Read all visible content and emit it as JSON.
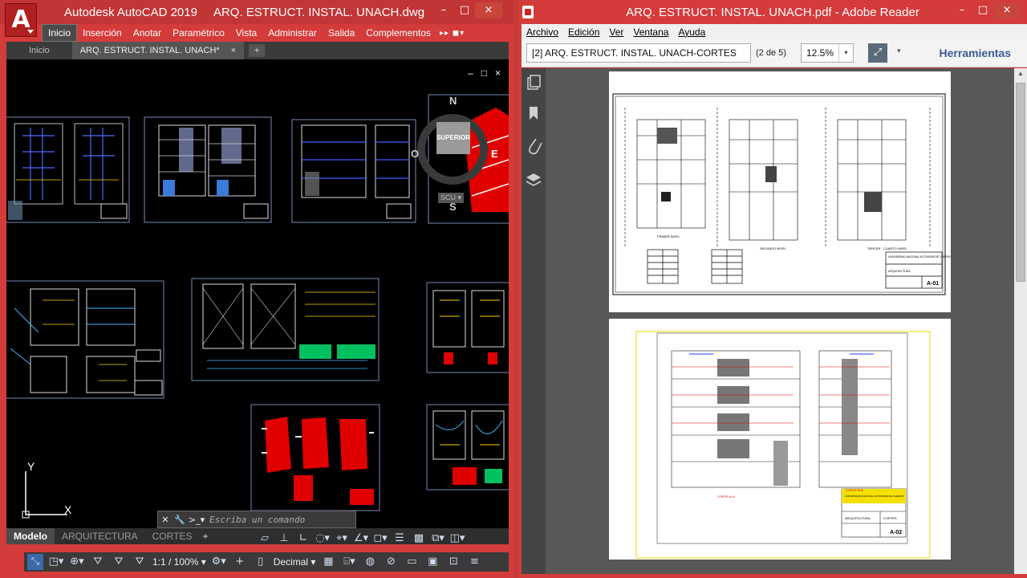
{
  "autocad": {
    "app_name": "Autodesk AutoCAD 2019",
    "document_title": "ARQ. ESTRUCT. INSTAL. UNACH.dwg",
    "logo_letter": "A",
    "ribbon_tabs": [
      "Inicio",
      "Inserción",
      "Anotar",
      "Paramétrico",
      "Vista",
      "Administrar",
      "Salida",
      "Complementos"
    ],
    "ribbon_extra": "▸▸ ◼▾",
    "doc_tabs": {
      "start": "Inicio",
      "active": "ARQ. ESTRUCT. INSTAL. UNACH*",
      "close": "×",
      "add": "+"
    },
    "viewport_controls": [
      "–",
      "□",
      "×"
    ],
    "viewcube": {
      "north": "N",
      "south": "S",
      "west": "O",
      "east": "E",
      "face": "SUPERIOR",
      "ucs_menu": "SCU ▾"
    },
    "ucs_icon": {
      "x": "X",
      "y": "Y"
    },
    "command_line": {
      "placeholder": "Escriba un comando",
      "close": "✕",
      "settings": "🔧",
      "prompt": ">_▾"
    },
    "layout_tabs": [
      "Modelo",
      "ARQUITECTURA",
      "CORTES"
    ],
    "layout_add": "+",
    "status_row1": [
      "▱",
      "⊥",
      "∟",
      "◌▾",
      "⌖▾",
      "∠▾",
      "◻▾",
      "☰",
      "▩",
      "⧉▾",
      "◫▾"
    ],
    "status_row2": [
      "⤡",
      "◳▾",
      "⊕▾",
      "⛛",
      "⛛",
      "⛛",
      "1:1 / 100% ▾",
      "⚙▾",
      "+",
      "▯",
      "Decimal ▾",
      "▦",
      "⌸▾",
      "◍",
      "⊘",
      "▭",
      "▣",
      "⊡",
      "≡"
    ],
    "colors": {
      "titlebar": "#c23535",
      "canvas": "#000000",
      "sheet_border": "#7a8ab8"
    }
  },
  "reader": {
    "window_title": "ARQ. ESTRUCT. INSTAL. UNACH.pdf - Adobe Reader",
    "menu": [
      "Archivo",
      "Edición",
      "Ver",
      "Ventana",
      "Ayuda"
    ],
    "document_name": "[2] ARQ. ESTRUCT. INSTAL. UNACH-CORTES",
    "page_counter": "(2 de 5)",
    "zoom": "12.5%",
    "zoom_dropdown": "▾",
    "expand_icon": "⤢",
    "arrow_icon": "▾",
    "tools_label": "Herramientas",
    "sidebar_icons": [
      "pages-icon",
      "bookmark-icon",
      "attachment-icon",
      "layers-icon"
    ],
    "window_buttons": [
      "–",
      "□",
      "×"
    ],
    "page1": {
      "labels": [
        "PRIMER NIVEL",
        "SEGUNDO NIVEL",
        "TERCER - CUARTO NIVEL"
      ],
      "sheet_id": "A-01",
      "org": "UNIVERSIDAD NACIONAL AUTONOMA DE CHIAPAS",
      "discipline": "ARQUITECTURA"
    },
    "page2": {
      "labels": [
        "CORTE A-A",
        "CORTE B-B"
      ],
      "sheet_id": "A-02",
      "org": "UNIVERSIDAD NACIONAL AUTONOMA DE CHIAPAS",
      "discipline": "ARQUITECTURA",
      "kind": "CORTES"
    }
  }
}
